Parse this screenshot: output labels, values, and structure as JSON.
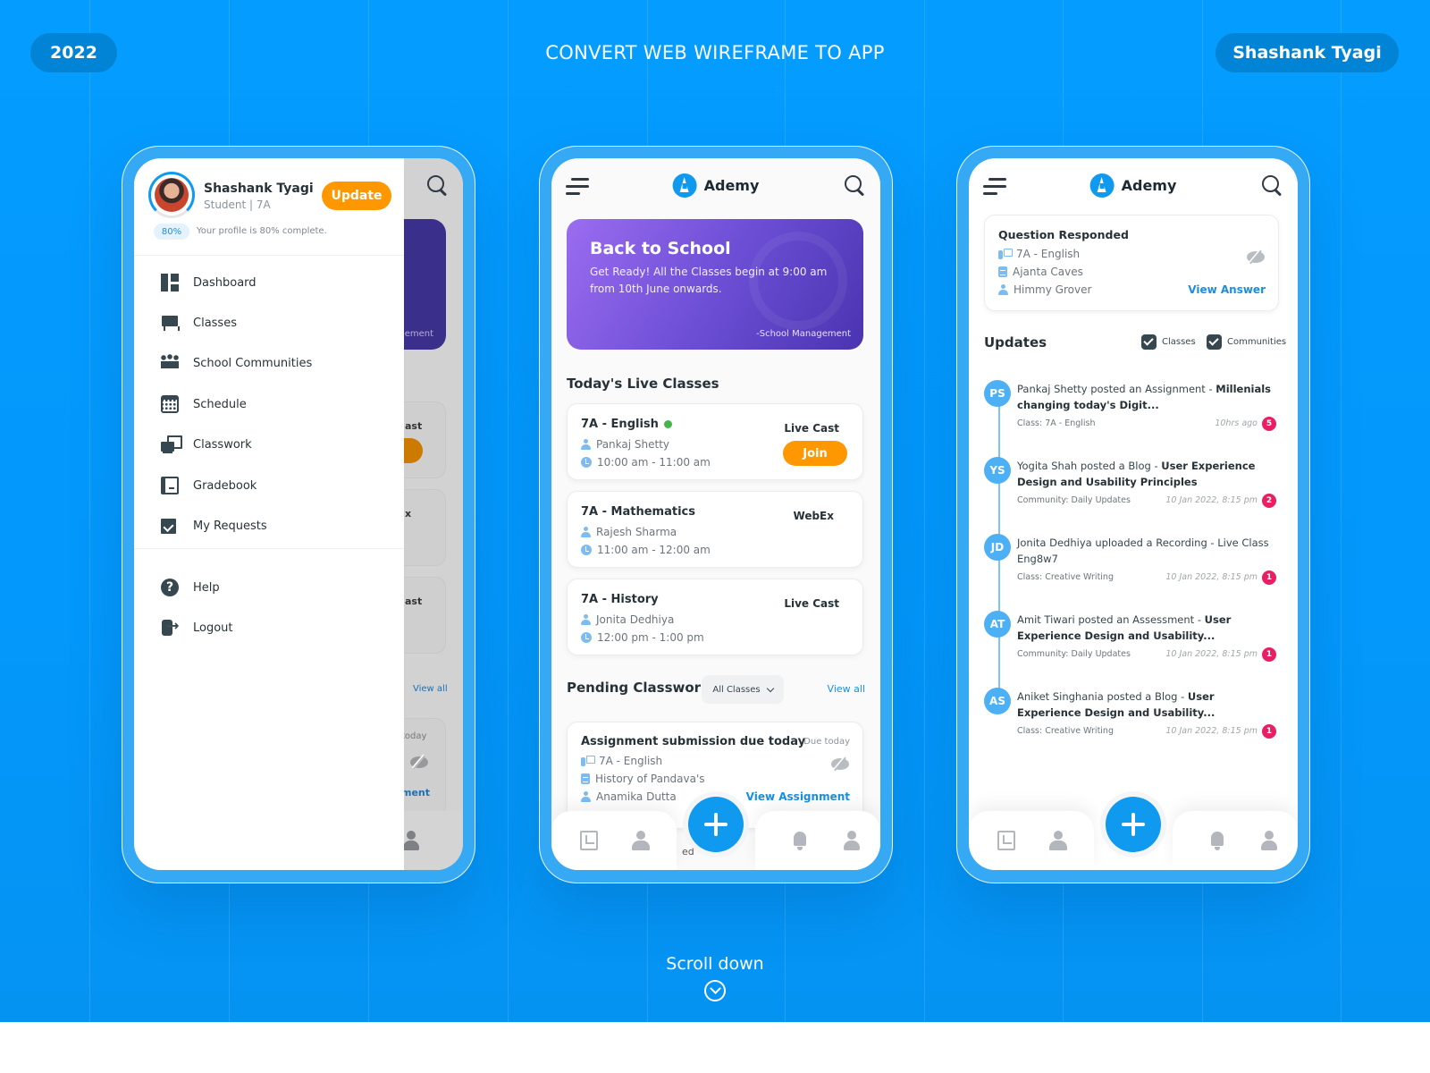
{
  "header": {
    "year": "2022",
    "title": "CONVERT WEB WIREFRAME TO APP",
    "author": "Shashank Tyagi"
  },
  "footer": {
    "scroll_label": "Scroll down",
    "scroll_icon": "chevron-down-circle-icon"
  },
  "colors": {
    "background": "#049cff",
    "brand_blue": "#0f9af0",
    "accent_orange": "#ff9800",
    "badge_red": "#e91e63",
    "banner_gradient": [
      "#9b6cf0",
      "#4a34b0"
    ],
    "text_dark": "#263238"
  },
  "app": {
    "name": "Ademy",
    "logo_icon": "ademy-a-logo-icon",
    "menu_icon": "hamburger-icon",
    "search_icon": "search-icon"
  },
  "drawer": {
    "user": {
      "name": "Shashank Tyagi",
      "role": "Student | 7A",
      "profile_complete_percent": 80,
      "profile_badge": "80%",
      "profile_text": "Your profile is 80% complete.",
      "update_label": "Update"
    },
    "menu": [
      {
        "label": "Dashboard",
        "icon": "dashboard-icon"
      },
      {
        "label": "Classes",
        "icon": "classroom-board-icon"
      },
      {
        "label": "School Communities",
        "icon": "community-icon"
      },
      {
        "label": "Schedule",
        "icon": "calendar-icon"
      },
      {
        "label": "Classwork",
        "icon": "classwork-icon"
      },
      {
        "label": "Gradebook",
        "icon": "gradebook-icon"
      },
      {
        "label": "My Requests",
        "icon": "checkbox-requests-icon"
      }
    ],
    "secondary_menu": [
      {
        "label": "Help",
        "icon": "help-circle-icon",
        "glyph": "?"
      },
      {
        "label": "Logout",
        "icon": "logout-icon"
      }
    ],
    "background_peek": {
      "banner_fragment": "ement",
      "card_fragments": [
        "ast",
        "x",
        "ast"
      ],
      "view_all": "View all",
      "due_fragment": "today",
      "link_fragment": "ment"
    }
  },
  "dashboard": {
    "banner": {
      "title": "Back to School",
      "body": "Get Ready! All the Classes begin at 9:00 am from 10th June onwards.",
      "signature": "-School Management"
    },
    "live_classes_title": "Today's Live Classes",
    "live_classes": [
      {
        "title": "7A - English",
        "live": true,
        "teacher": "Pankaj Shetty",
        "time": "10:00 am - 11:00 am",
        "platform": "Live Cast",
        "action": "Join"
      },
      {
        "title": "7A - Mathematics",
        "live": false,
        "teacher": "Rajesh Sharma",
        "time": "11:00 am - 12:00 am",
        "platform": "WebEx"
      },
      {
        "title": "7A - History",
        "live": false,
        "teacher": "Jonita Dedhiya",
        "time": "12:00 pm - 1:00 pm",
        "platform": "Live Cast"
      }
    ],
    "pending_title": "Pending Classwork",
    "filter_selected": "All Classes",
    "view_all": "View all",
    "pending_card": {
      "title": "Assignment submission due today",
      "due": "Due today",
      "class": "7A - English",
      "topic": "History of Pandava's",
      "teacher": "Anamika Dutta",
      "action": "View Assignment"
    }
  },
  "updates_screen": {
    "question_card": {
      "title": "Question Responded",
      "class": "7A - English",
      "topic": "Ajanta Caves",
      "student": "Himmy Grover",
      "action": "View Answer"
    },
    "updates_title": "Updates",
    "filters": [
      {
        "label": "Classes",
        "checked": true
      },
      {
        "label": "Communities",
        "checked": true
      }
    ],
    "items": [
      {
        "initials": "PS",
        "text": "Pankaj Shetty posted an Assignment - ",
        "bold": "Millenials changing today's Digit...",
        "meta": "Class: 7A - English",
        "time": "10hrs ago",
        "count": "5"
      },
      {
        "initials": "YS",
        "text": "Yogita Shah posted a Blog - ",
        "bold": "User Experience Design and Usability Principles",
        "meta": "Community: Daily Updates",
        "time": "10 Jan 2022, 8:15 pm",
        "count": "2"
      },
      {
        "initials": "JD",
        "text": "Jonita Dedhiya uploaded a Recording - Live Class Eng8w7",
        "bold": "",
        "meta": "Class: Creative Writing",
        "time": "10 Jan 2022, 8:15 pm",
        "count": "1"
      },
      {
        "initials": "AT",
        "text": "Amit Tiwari posted an Assessment - ",
        "bold": "User Experience Design and Usability...",
        "meta": "Community: Daily Updates",
        "time": "10 Jan 2022, 8:15 pm",
        "count": "1"
      },
      {
        "initials": "AS",
        "text": "Aniket Singhania posted a Blog - ",
        "bold": "User Experience Design and Usability...",
        "meta": "Class: Creative Writing",
        "time": "10 Jan 2022, 8:15 pm",
        "count": "1"
      }
    ]
  },
  "bottom_nav": {
    "items": [
      {
        "icon": "gradebook-chart-icon"
      },
      {
        "icon": "teacher-icon"
      },
      {
        "icon": "add-icon"
      },
      {
        "icon": "bell-icon"
      },
      {
        "icon": "profile-icon"
      }
    ],
    "peek_text": "ed"
  }
}
